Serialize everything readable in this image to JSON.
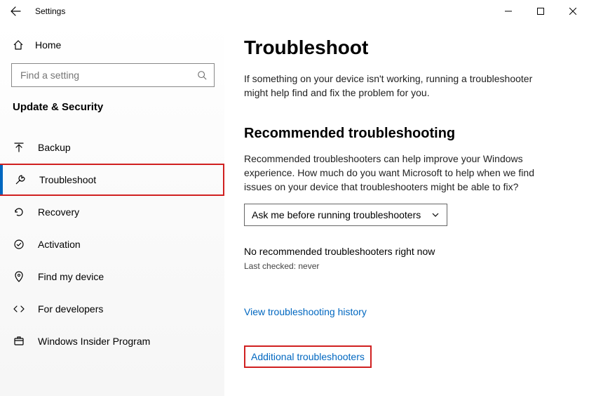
{
  "window": {
    "title": "Settings"
  },
  "sidebar": {
    "home_label": "Home",
    "search_placeholder": "Find a setting",
    "section_title": "Update & Security",
    "items": [
      {
        "label": "Backup"
      },
      {
        "label": "Troubleshoot"
      },
      {
        "label": "Recovery"
      },
      {
        "label": "Activation"
      },
      {
        "label": "Find my device"
      },
      {
        "label": "For developers"
      },
      {
        "label": "Windows Insider Program"
      }
    ]
  },
  "main": {
    "heading": "Troubleshoot",
    "intro": "If something on your device isn't working, running a troubleshooter might help find and fix the problem for you.",
    "rec_heading": "Recommended troubleshooting",
    "rec_body": "Recommended troubleshooters can help improve your Windows experience. How much do you want Microsoft to help when we find issues on your device that troubleshooters might be able to fix?",
    "dropdown_value": "Ask me before running troubleshooters",
    "no_rec": "No recommended troubleshooters right now",
    "last_checked": "Last checked: never",
    "link_history": "View troubleshooting history",
    "link_additional": "Additional troubleshooters"
  }
}
